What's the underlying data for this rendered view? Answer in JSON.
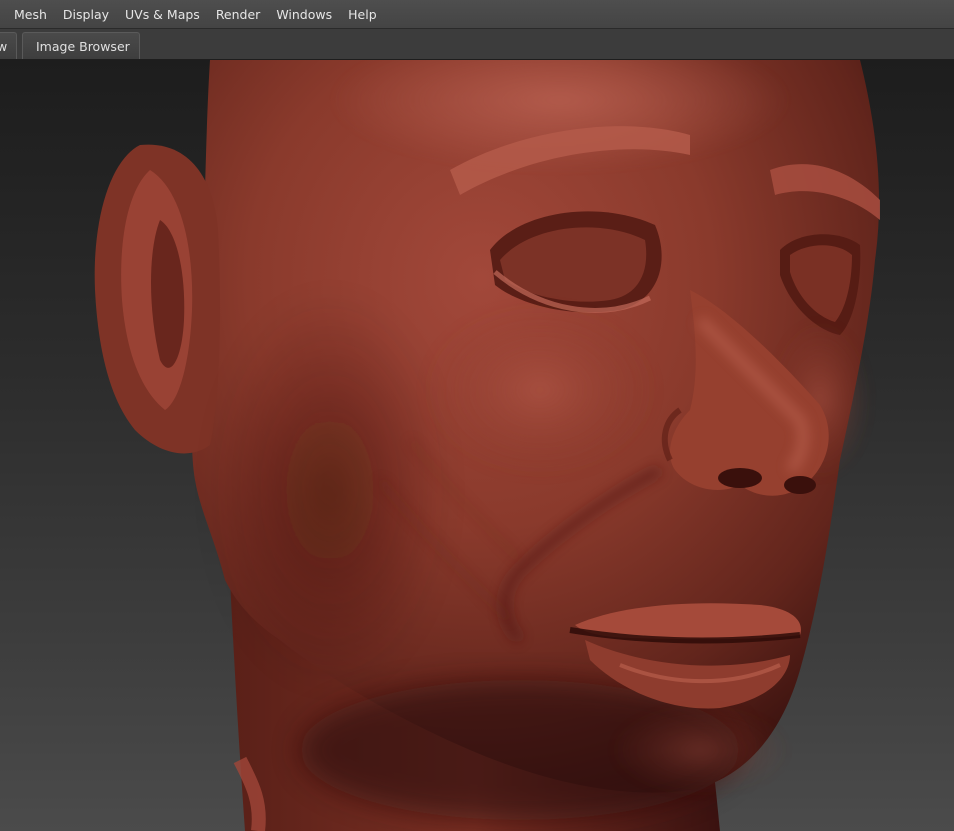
{
  "menubar": {
    "items": [
      {
        "label": "Mesh"
      },
      {
        "label": "Display"
      },
      {
        "label": "UVs & Maps"
      },
      {
        "label": "Render"
      },
      {
        "label": "Windows"
      },
      {
        "label": "Help"
      }
    ]
  },
  "tabs": [
    {
      "label": "w"
    },
    {
      "label": "Image Browser"
    }
  ],
  "viewport": {
    "content": "sculpt-model",
    "colors": {
      "skin": "#8a3a2c",
      "skin_light": "#b65a4a",
      "skin_dark": "#4a1812",
      "background_top": "#1d1d1d",
      "background_bottom": "#4b4b4b"
    }
  }
}
